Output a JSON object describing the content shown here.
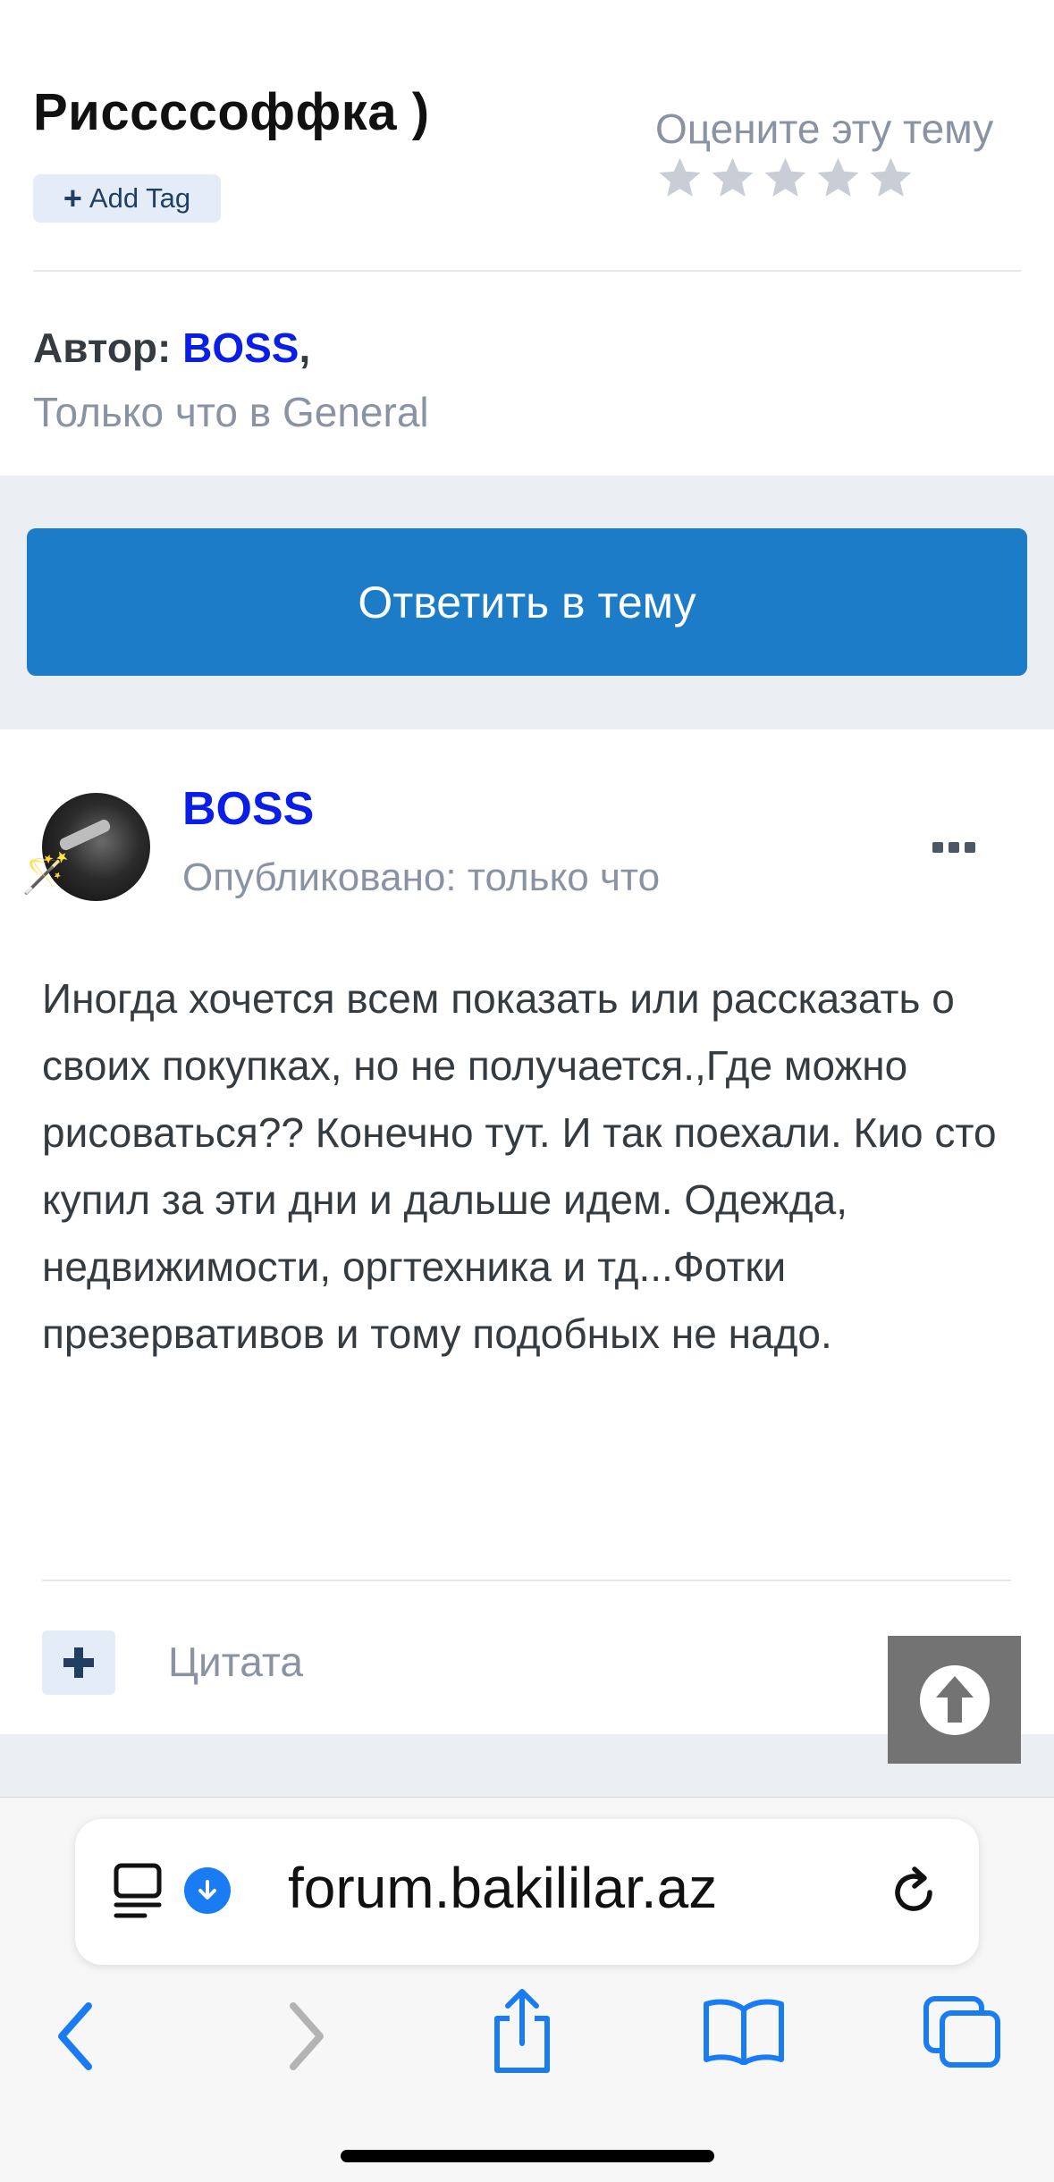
{
  "topic": {
    "title": "Риссссоффка )",
    "add_tag_label": "Add Tag",
    "rate_label": "Оцените эту тему",
    "rating_stars_filled": 0,
    "rating_stars_total": 5,
    "author_prefix": "Автор:",
    "author_name": "BOSS",
    "author_suffix": ",",
    "posted_in": "Только что в General"
  },
  "reply_button_label": "Ответить в тему",
  "post": {
    "author": "BOSS",
    "date": "Опубликовано: только что",
    "body": "Иногда хочется всем показать или рассказать о своих покупках, но не получается.,Где можно рисоваться?? Конечно тут. И так поехали. Кио сто купил за эти дни и дальше идем. Одежда, недвижимости, оргтехника и тд...Фотки презервативов и тому подобных не надо.",
    "quote_label": "Цитата"
  },
  "browser": {
    "url": "forum.bakililar.az"
  },
  "colors": {
    "accent": "#1c7cc8",
    "author_link": "#0a1ee8",
    "muted_text": "#8a93a3",
    "browser_blue": "#1a7cf5"
  },
  "icons": [
    "plus-icon",
    "star-icon",
    "more-icon",
    "avatar",
    "magic-wand-icon",
    "scroll-top-icon",
    "reader-icon",
    "download-icon",
    "reload-icon",
    "back-icon",
    "forward-icon",
    "share-icon",
    "bookmarks-icon",
    "tabs-icon"
  ]
}
